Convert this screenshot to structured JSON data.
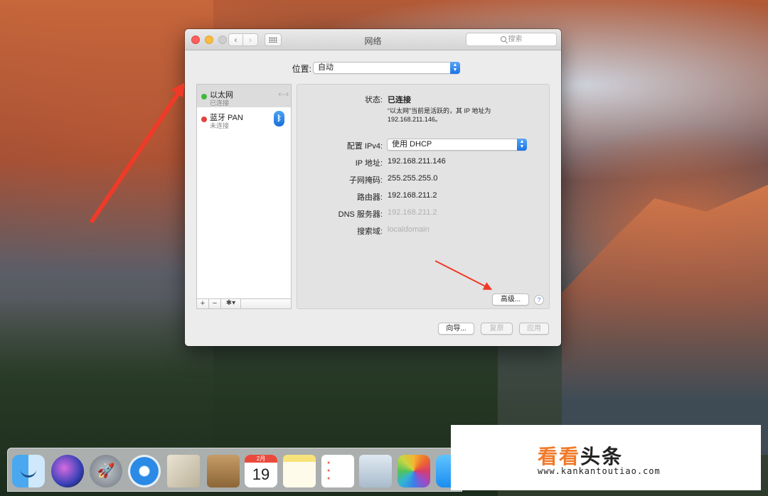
{
  "window": {
    "title": "网络",
    "search_placeholder": "搜索"
  },
  "location": {
    "label": "位置:",
    "value": "自动"
  },
  "services": [
    {
      "name": "以太网",
      "status": "已连接",
      "status_color": "#43b63d",
      "icon": "ethernet-arrows-icon"
    },
    {
      "name": "蓝牙 PAN",
      "status": "未连接",
      "status_color": "#e0443e",
      "icon": "bluetooth-icon"
    }
  ],
  "sidebar_tools": {
    "add": "+",
    "remove": "−",
    "action": "✱▾"
  },
  "detail": {
    "status_label": "状态:",
    "status_value": "已连接",
    "status_desc": "“以太网”当前是活跃的，其 IP 地址为 192.168.211.146。",
    "ipv4_label": "配置 IPv4:",
    "ipv4_value": "使用 DHCP",
    "ip_label": "IP 地址:",
    "ip_value": "192.168.211.146",
    "subnet_label": "子网掩码:",
    "subnet_value": "255.255.255.0",
    "router_label": "路由器:",
    "router_value": "192.168.211.2",
    "dns_label": "DNS 服务器:",
    "dns_value": "192.168.211.2",
    "domain_label": "搜索域:",
    "domain_value": "localdomain",
    "advanced_label": "高级...",
    "help_label": "?"
  },
  "footer": {
    "assist_label": "向导...",
    "revert_label": "复原",
    "apply_label": "应用"
  },
  "dock": {
    "calendar_month": "2月",
    "calendar_day": "19"
  },
  "watermark": {
    "title_orange": "看看",
    "title_black": "头条",
    "url": "www.kankantoutiao.com"
  },
  "colors": {
    "annotation_arrow": "#f03a28",
    "accent_blue": "#1c74e6"
  }
}
